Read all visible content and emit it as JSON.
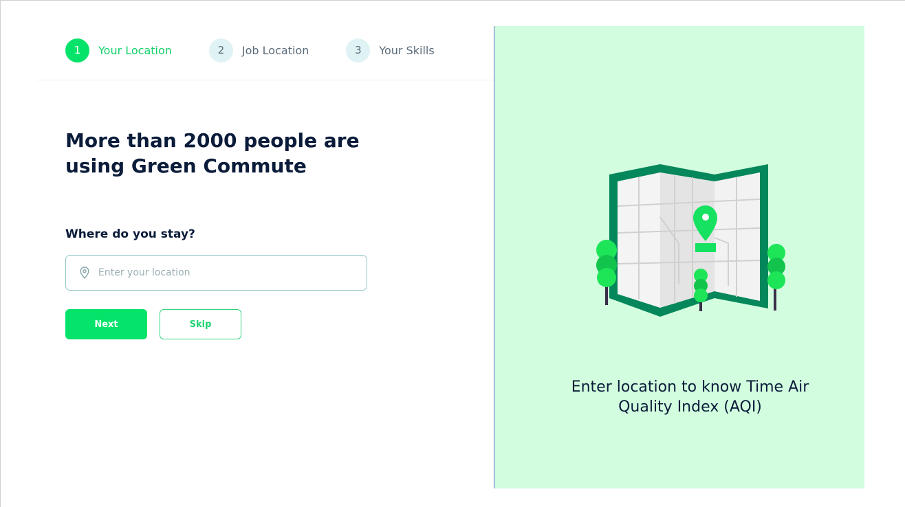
{
  "stepper": {
    "steps": [
      {
        "number": "1",
        "label": "Your Location",
        "state": "active"
      },
      {
        "number": "2",
        "label": "Job Location",
        "state": "inactive"
      },
      {
        "number": "3",
        "label": "Your Skills",
        "state": "inactive"
      }
    ]
  },
  "main": {
    "headline": "More than 2000 people are using Green Commute",
    "question": "Where do you stay?",
    "location_input": {
      "placeholder": "Enter your location",
      "value": ""
    },
    "next_label": "Next",
    "skip_label": "Skip"
  },
  "panel": {
    "caption": "Enter location to know Time Air Quality Index (AQI)",
    "illustration_icon": "folded-map-with-pin-icon"
  },
  "colors": {
    "accent": "#06e36a",
    "panel_bg": "#d2fddf",
    "map_frame": "#04875a",
    "text_dark": "#0b1c3a"
  }
}
